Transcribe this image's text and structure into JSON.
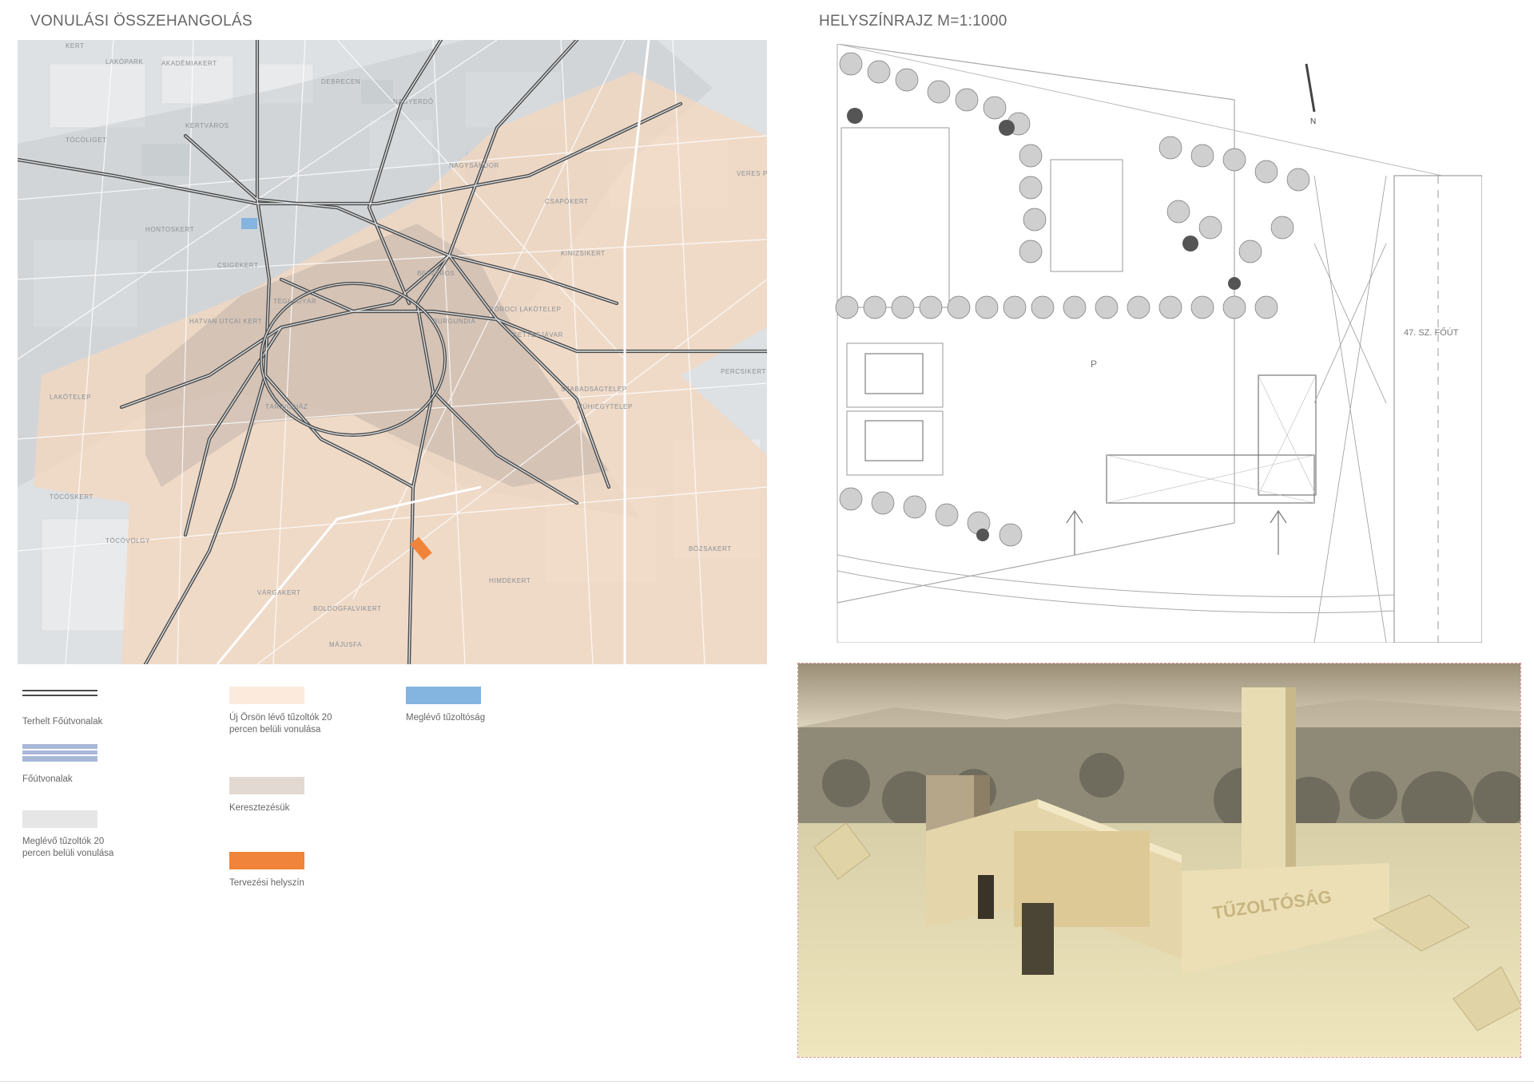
{
  "map_title": "VONULÁSI ÖSSZEHANGOLÁS",
  "plan_title": "HELYSZÍNRAJZ M=1:1000",
  "legend": [
    {
      "id": "loaded-main-routes",
      "label": "Terhelt Főútvonalak",
      "style": "double-line",
      "color": "#4a4a4a"
    },
    {
      "id": "main-routes",
      "label": "Főútvonalak",
      "style": "striped",
      "color": "#a9b8d8"
    },
    {
      "id": "existing-coverage",
      "label": "Meglévő tűzoltók 20 percen belüli vonulása",
      "style": "fill",
      "color": "#e6e6e6"
    },
    {
      "id": "new-coverage",
      "label": "Új Örsön lévő tűzoltók 20 percen belüli vonulása",
      "style": "fill",
      "color": "#fcebdd"
    },
    {
      "id": "intersection",
      "label": "Keresztezésük",
      "style": "fill",
      "color": "#e2d9d2"
    },
    {
      "id": "design-site",
      "label": "Tervezési helyszín",
      "style": "fill",
      "color": "#f0843a"
    },
    {
      "id": "existing-station",
      "label": "Meglévő tűzoltóság",
      "style": "fill",
      "color": "#84b4e0"
    }
  ],
  "map_labels": [
    "KERT",
    "LAKÓPARK",
    "AKADÉMIAKERT",
    "TÓCÓLIGET",
    "KERTVÁROS",
    "NAGYERDŐ",
    "NAGYSÁNDOR",
    "CSAPÓKERT",
    "KINIZSIKERT",
    "HONTOSKERT",
    "CSIGEKERT",
    "BELVÁROS",
    "BURGUNDIA",
    "DÓROCI LAKÓTELEP",
    "KETTESJÁVAR",
    "SZABADSÁGTELEP",
    "MÚHIEGYTELEP",
    "TÉGLAGYÁR",
    "TÁRSASHÁZ",
    "HATVAN UTCAI KERT",
    "LAKÓTELEP",
    "TÓCÓVÖLGY",
    "VÁRGAKERT",
    "BOLDOGFALVIKERT",
    "MÁJUSFA",
    "HIMDEKERT",
    "BÓZSAKERT",
    "PERCSIKERT",
    "DEBRECEN",
    "VERES PÉTER",
    "TÓCÓSKERT"
  ],
  "plan": {
    "road_label": "47. SZ. FŐÚT",
    "parking_symbol": "P",
    "north_symbol": "N"
  },
  "render": {
    "sign_text": "TŰZOLTÓSÁG"
  }
}
